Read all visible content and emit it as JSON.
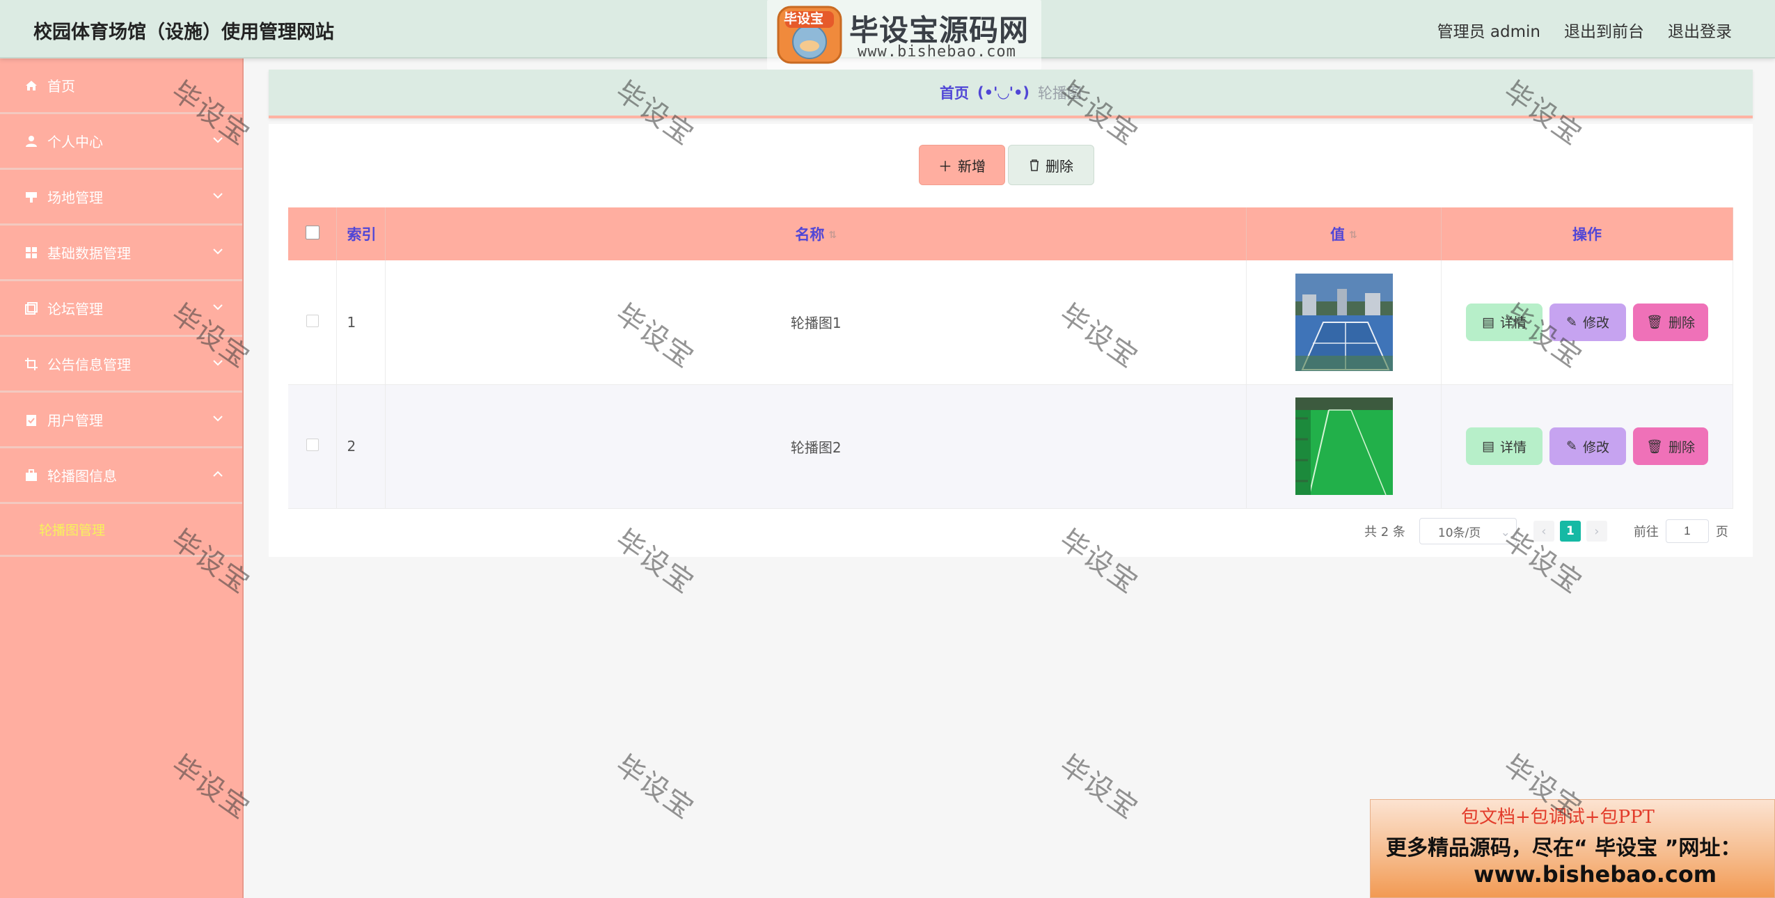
{
  "header": {
    "title": "校园体育场馆（设施）使用管理网站",
    "admin_label": "管理员 admin",
    "to_front": "退出到前台",
    "logout": "退出登录"
  },
  "logo_watermark": {
    "badge_text": "毕设宝",
    "name": "毕设宝源码网",
    "url": "www.bishebao.com"
  },
  "sidebar": {
    "items": [
      {
        "label": "首页",
        "icon": "home-icon"
      },
      {
        "label": "个人中心",
        "icon": "user-icon"
      },
      {
        "label": "场地管理",
        "icon": "venue-icon"
      },
      {
        "label": "基础数据管理",
        "icon": "grid-icon"
      },
      {
        "label": "论坛管理",
        "icon": "forum-icon"
      },
      {
        "label": "公告信息管理",
        "icon": "crop-icon"
      },
      {
        "label": "用户管理",
        "icon": "clipboard-icon"
      },
      {
        "label": "轮播图信息",
        "icon": "briefcase-icon"
      }
    ],
    "subitem": "轮播图管理"
  },
  "breadcrumb": {
    "home": "首页",
    "separator": "(•'◡'•)",
    "current": "轮播图"
  },
  "toolbar": {
    "add": "新增",
    "delete": "删除"
  },
  "table": {
    "headers": {
      "index": "索引",
      "name": "名称",
      "value": "值",
      "ops": "操作"
    },
    "rows": [
      {
        "index": "1",
        "name": "轮播图1",
        "image": "tennis-court-photo"
      },
      {
        "index": "2",
        "name": "轮播图2",
        "image": "soccer-field-photo"
      }
    ],
    "op_detail": "详情",
    "op_edit": "修改",
    "op_delete": "删除"
  },
  "pagination": {
    "total": "共 2 条",
    "page_size": "10条/页",
    "current_page": "1",
    "goto_label": "前往",
    "goto_value": "1",
    "page_suffix": "页"
  },
  "watermark": {
    "text": "毕设宝"
  },
  "ad": {
    "line1": "包文档+包调试+包PPT",
    "line2": "更多精品源码，尽在“ 毕设宝 ”网址：",
    "line3": "www.bishebao.com"
  },
  "colors": {
    "header_bg": "#dcebe3",
    "sidebar_bg": "#ffaea0",
    "accent_text": "#5046d6",
    "submenu_text": "#f7f25c",
    "pager_active": "#15b9a4"
  }
}
